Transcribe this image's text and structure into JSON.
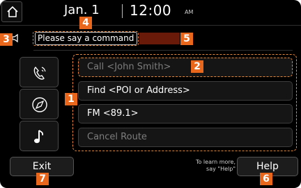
{
  "status": {
    "date": "Jan.  1",
    "time": "12:00",
    "ampm": "AM"
  },
  "prompt": {
    "text": "Please say a command"
  },
  "sidebar": {
    "icons": [
      "phone-voice-icon",
      "navigation-compass-icon",
      "music-note-icon"
    ]
  },
  "commands": [
    {
      "label": "Call <John Smith>",
      "state": "dim"
    },
    {
      "label": "Find <POI or Address>",
      "state": "active"
    },
    {
      "label": "FM <89.1>",
      "state": "active"
    },
    {
      "label": "Cancel Route",
      "state": "dim"
    }
  ],
  "footer": {
    "exit_label": "Exit",
    "help_label": "Help",
    "hint_line1": "To learn more,",
    "hint_line2": "say \"Help\""
  },
  "callouts": {
    "c1": "1",
    "c2": "2",
    "c3": "3",
    "c4": "4",
    "c5": "5",
    "c6": "6",
    "c7": "7"
  },
  "colors": {
    "accent": "#e9661d",
    "level_bar": "#6a1a08",
    "background": "#000000"
  }
}
